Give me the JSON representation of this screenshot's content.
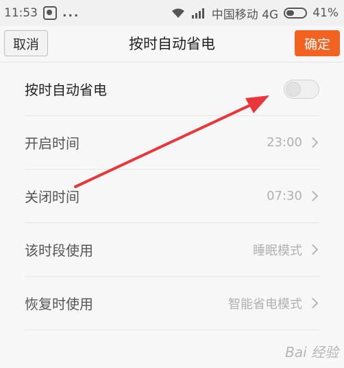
{
  "status_bar": {
    "time": "11:53",
    "dots": "...",
    "carrier": "中国移动 4G",
    "battery_text": "41%",
    "battery_level": 0.41
  },
  "header": {
    "cancel_label": "取消",
    "title": "按时自动省电",
    "confirm_label": "确定",
    "confirm_color": "#f26322"
  },
  "list": [
    {
      "label": "按时自动省电",
      "toggle_on": false
    },
    {
      "label": "开启时间",
      "value": "23:00"
    },
    {
      "label": "关闭时间",
      "value": "07:30"
    },
    {
      "label": "该时段使用",
      "value": "睡眠模式"
    },
    {
      "label": "恢复时使用",
      "value": "智能省电模式"
    }
  ],
  "annotation": {
    "arrow_color": "#e8363a"
  },
  "watermark": {
    "text": "Bai 经验"
  }
}
